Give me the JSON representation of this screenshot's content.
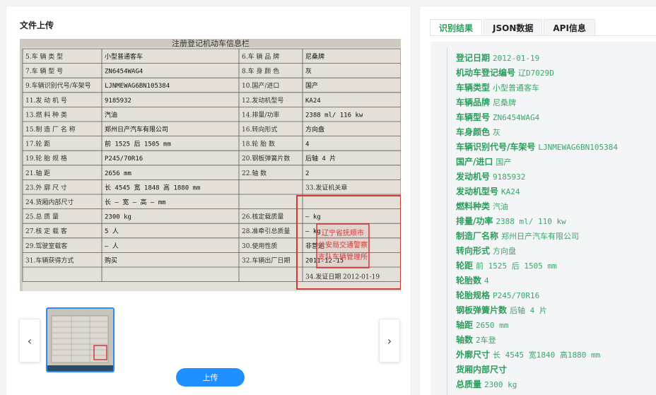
{
  "upload": {
    "title": "文件上传",
    "button_label": "上传",
    "prev_label": "‹",
    "next_label": "›",
    "document": {
      "header": "注册登记机动车信息栏",
      "cells": [
        "5.车 辆 类 型",
        "小型普通客车",
        "6.车 辆 品 牌",
        "尼桑牌",
        "7.车 辆 型 号",
        "ZN6454WAG4",
        "8.车 身 颜 色",
        "灰",
        "9.车辆识别代号/车架号",
        "LJNMEWAG6BN105384",
        "10.国产/进口",
        "国产",
        "11.发 动 机 号",
        "9185932",
        "12.发动机型号",
        "KA24",
        "13.燃 料 种 类",
        "汽油",
        "14.排量/功率",
        "2388 ml/ 116 kw",
        "15.制 造 厂 名 称",
        "郑州日产汽车有限公司",
        "16.转向形式",
        "方向盘",
        "17.轮 距",
        "前 1525 后 1505 mm",
        "18.轮 胎 数",
        "4",
        "19.轮 胎 规 格",
        "P245/70R16",
        "20.钢板弹簧片数",
        "后轴 4 片",
        "21.轴 距",
        "2656 mm",
        "22.轴 数",
        "2",
        "23.外 廓 尺 寸",
        "长 4545 宽 1848 高 1880 mm",
        "24.货厢内部尺寸",
        "长 — 宽 — 高 — mm",
        "25.总 质 量",
        "2300 kg",
        "26.核定载质量",
        "— kg",
        "27.核 定 载 客",
        "5 人",
        "28.准牵引总质量",
        "— kg",
        "29.驾驶室载客",
        "— 人",
        "30.使用性质",
        "非营运",
        "31.车辆获得方式",
        "购买",
        "32.车辆出厂日期",
        "2011-12-15",
        "33.发证机关章",
        "34.发证日期",
        "2012-01-19"
      ],
      "stamp": [
        "辽宁省抚顺市",
        "公安局交通警察",
        "支队车辆管理所"
      ]
    }
  },
  "tabs": [
    {
      "label": "识别结果",
      "active": true
    },
    {
      "label": "JSON数据",
      "active": false
    },
    {
      "label": "API信息",
      "active": false
    }
  ],
  "results": [
    {
      "key": "登记日期",
      "value": "2012-01-19"
    },
    {
      "key": "机动车登记编号",
      "value": "辽D7029D"
    },
    {
      "key": "车辆类型",
      "value": "小型普通客车"
    },
    {
      "key": "车辆品牌",
      "value": "尼桑牌"
    },
    {
      "key": "车辆型号",
      "value": "ZN6454WAG4"
    },
    {
      "key": "车身颜色",
      "value": "灰"
    },
    {
      "key": "车辆识别代号/车架号",
      "value": "LJNMEWAG6BN105384"
    },
    {
      "key": "国产/进口",
      "value": "国产"
    },
    {
      "key": "发动机号",
      "value": "9185932"
    },
    {
      "key": "发动机型号",
      "value": "KA24"
    },
    {
      "key": "燃料种类",
      "value": "汽油"
    },
    {
      "key": "排量/功率",
      "value": "2388 ml/ 110 kw"
    },
    {
      "key": "制造厂名称",
      "value": "郑州日产汽车有限公司"
    },
    {
      "key": "转向形式",
      "value": "方向盘"
    },
    {
      "key": "轮距",
      "value": "前 1525 后 1505 mm"
    },
    {
      "key": "轮胎数",
      "value": "4"
    },
    {
      "key": "轮胎规格",
      "value": "P245/70R16"
    },
    {
      "key": "钢板弹簧片数",
      "value": "后轴 4 片"
    },
    {
      "key": "轴距",
      "value": "2650 mm"
    },
    {
      "key": "轴数",
      "value": "2车登"
    },
    {
      "key": "外廓尺寸",
      "value": "长 4545 宽1840 高1880 mm"
    },
    {
      "key": "货厢内部尺寸",
      "value": ""
    },
    {
      "key": "总质量",
      "value": "2300 kg"
    }
  ],
  "colors": {
    "accent_green": "#2a9d5c",
    "button_blue": "#1e90ff",
    "stamp_red": "#d23a3a"
  }
}
